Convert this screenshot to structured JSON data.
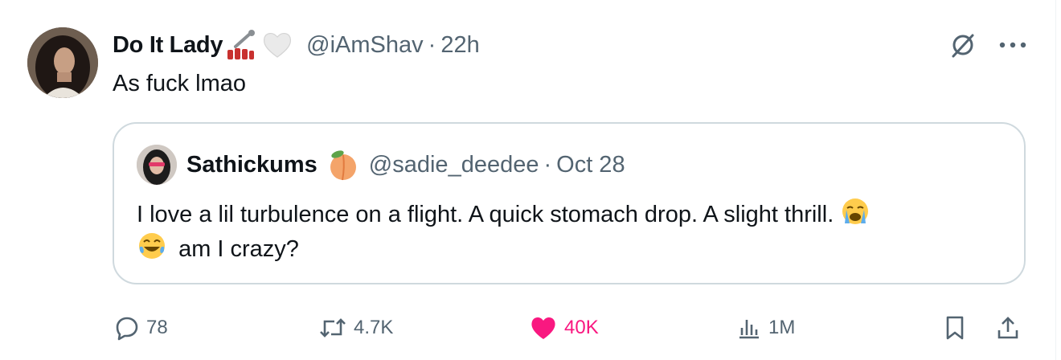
{
  "tweet": {
    "display_name": "Do It Lady",
    "name_emojis": [
      "nail-polish-emoji",
      "white-heart-emoji"
    ],
    "handle": "@iAmShav",
    "separator": "·",
    "time": "22h",
    "text": "As fuck lmao"
  },
  "quote": {
    "display_name": "Sathickums",
    "name_emoji": "peach-emoji",
    "handle": "@sadie_deedee",
    "separator": "·",
    "date": "Oct 28",
    "text_line1": "I love a lil turbulence on a flight. A quick stomach drop. A slight thrill.",
    "text_line2": "am I crazy?",
    "emojis": [
      "loudly-crying-face-emoji",
      "tears-of-joy-emoji"
    ]
  },
  "actions": {
    "replies": "78",
    "reposts": "4.7K",
    "likes": "40K",
    "views": "1M",
    "like_color": "#f91880",
    "icon_color": "#536471"
  },
  "top_icons": [
    "grok-icon",
    "more-icon"
  ]
}
